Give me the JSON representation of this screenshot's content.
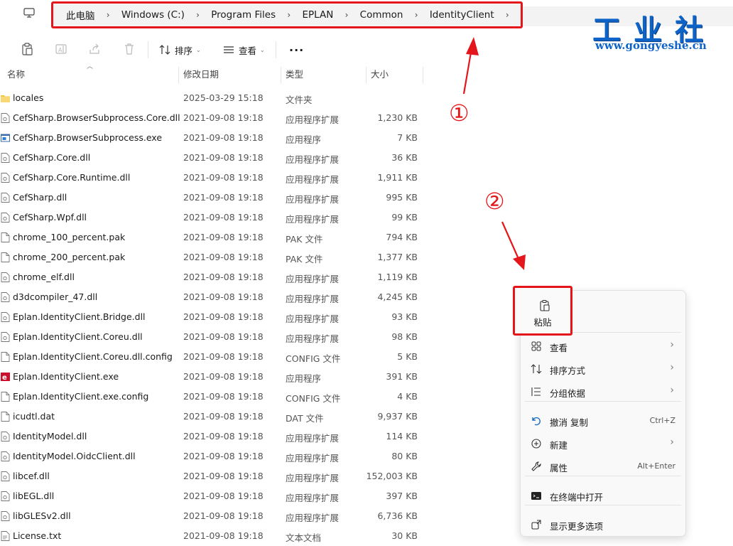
{
  "breadcrumb": {
    "items": [
      "此电脑",
      "Windows (C:)",
      "Program Files",
      "EPLAN",
      "Common",
      "IdentityClient"
    ],
    "separator": "›"
  },
  "toolbar": {
    "sort_label": "排序",
    "view_label": "查看",
    "more_label": "···"
  },
  "columns": {
    "name": "名称",
    "date": "修改日期",
    "type": "类型",
    "size": "大小"
  },
  "files": [
    {
      "name": "locales",
      "date": "2025-03-29 15:18",
      "type": "文件夹",
      "size": "",
      "icon": "folder-icon"
    },
    {
      "name": "CefSharp.BrowserSubprocess.Core.dll",
      "date": "2021-09-08 19:18",
      "type": "应用程序扩展",
      "size": "1,230 KB",
      "icon": "dll-file-icon"
    },
    {
      "name": "CefSharp.BrowserSubprocess.exe",
      "date": "2021-09-08 19:18",
      "type": "应用程序",
      "size": "7 KB",
      "icon": "exe-file-icon"
    },
    {
      "name": "CefSharp.Core.dll",
      "date": "2021-09-08 19:18",
      "type": "应用程序扩展",
      "size": "36 KB",
      "icon": "dll-file-icon"
    },
    {
      "name": "CefSharp.Core.Runtime.dll",
      "date": "2021-09-08 19:18",
      "type": "应用程序扩展",
      "size": "1,911 KB",
      "icon": "dll-file-icon"
    },
    {
      "name": "CefSharp.dll",
      "date": "2021-09-08 19:18",
      "type": "应用程序扩展",
      "size": "995 KB",
      "icon": "dll-file-icon"
    },
    {
      "name": "CefSharp.Wpf.dll",
      "date": "2021-09-08 19:18",
      "type": "应用程序扩展",
      "size": "99 KB",
      "icon": "dll-file-icon"
    },
    {
      "name": "chrome_100_percent.pak",
      "date": "2021-09-08 19:18",
      "type": "PAK 文件",
      "size": "794 KB",
      "icon": "file-icon"
    },
    {
      "name": "chrome_200_percent.pak",
      "date": "2021-09-08 19:18",
      "type": "PAK 文件",
      "size": "1,377 KB",
      "icon": "file-icon"
    },
    {
      "name": "chrome_elf.dll",
      "date": "2021-09-08 19:18",
      "type": "应用程序扩展",
      "size": "1,119 KB",
      "icon": "dll-file-icon"
    },
    {
      "name": "d3dcompiler_47.dll",
      "date": "2021-09-08 19:18",
      "type": "应用程序扩展",
      "size": "4,245 KB",
      "icon": "dll-file-icon"
    },
    {
      "name": "Eplan.IdentityClient.Bridge.dll",
      "date": "2021-09-08 19:18",
      "type": "应用程序扩展",
      "size": "93 KB",
      "icon": "dll-file-icon"
    },
    {
      "name": "Eplan.IdentityClient.Coreu.dll",
      "date": "2021-09-08 19:18",
      "type": "应用程序扩展",
      "size": "98 KB",
      "icon": "dll-file-icon"
    },
    {
      "name": "Eplan.IdentityClient.Coreu.dll.config",
      "date": "2021-09-08 19:18",
      "type": "CONFIG 文件",
      "size": "5 KB",
      "icon": "file-icon"
    },
    {
      "name": "Eplan.IdentityClient.exe",
      "date": "2021-09-08 19:18",
      "type": "应用程序",
      "size": "391 KB",
      "icon": "eplan-exe-icon"
    },
    {
      "name": "Eplan.IdentityClient.exe.config",
      "date": "2021-09-08 19:18",
      "type": "CONFIG 文件",
      "size": "4 KB",
      "icon": "file-icon"
    },
    {
      "name": "icudtl.dat",
      "date": "2021-09-08 19:18",
      "type": "DAT 文件",
      "size": "9,937 KB",
      "icon": "file-icon"
    },
    {
      "name": "IdentityModel.dll",
      "date": "2021-09-08 19:18",
      "type": "应用程序扩展",
      "size": "114 KB",
      "icon": "dll-file-icon"
    },
    {
      "name": "IdentityModel.OidcClient.dll",
      "date": "2021-09-08 19:18",
      "type": "应用程序扩展",
      "size": "80 KB",
      "icon": "dll-file-icon"
    },
    {
      "name": "libcef.dll",
      "date": "2021-09-08 19:18",
      "type": "应用程序扩展",
      "size": "152,003 KB",
      "icon": "dll-file-icon"
    },
    {
      "name": "libEGL.dll",
      "date": "2021-09-08 19:18",
      "type": "应用程序扩展",
      "size": "397 KB",
      "icon": "dll-file-icon"
    },
    {
      "name": "libGLESv2.dll",
      "date": "2021-09-08 19:18",
      "type": "应用程序扩展",
      "size": "6,736 KB",
      "icon": "dll-file-icon"
    },
    {
      "name": "License.txt",
      "date": "2021-09-08 19:18",
      "type": "文本文档",
      "size": "30 KB",
      "icon": "text-file-icon"
    }
  ],
  "context_menu": {
    "paste_label": "粘贴",
    "items": [
      {
        "label": "查看",
        "shortcut": "",
        "submenu": true,
        "icon": "grid-view-icon"
      },
      {
        "label": "排序方式",
        "shortcut": "",
        "submenu": true,
        "icon": "sort-icon"
      },
      {
        "label": "分组依据",
        "shortcut": "",
        "submenu": true,
        "icon": "group-icon"
      },
      {
        "label": "撤消 复制",
        "shortcut": "Ctrl+Z",
        "submenu": false,
        "icon": "undo-icon"
      },
      {
        "label": "新建",
        "shortcut": "",
        "submenu": true,
        "icon": "new-icon"
      },
      {
        "label": "属性",
        "shortcut": "Alt+Enter",
        "submenu": false,
        "icon": "wrench-icon"
      },
      {
        "label": "在终端中打开",
        "shortcut": "",
        "submenu": false,
        "icon": "terminal-icon"
      },
      {
        "label": "显示更多选项",
        "shortcut": "",
        "submenu": false,
        "icon": "more-options-icon"
      }
    ]
  },
  "watermark": {
    "logo_text": "工业社",
    "url": "www.gongyeshe.cn"
  },
  "annotations": {
    "step1": "①",
    "step2": "②"
  },
  "colors": {
    "highlight_red": "#e5161b",
    "logo_blue": "#0e63c8",
    "folder_yellow": "#f4c542"
  }
}
